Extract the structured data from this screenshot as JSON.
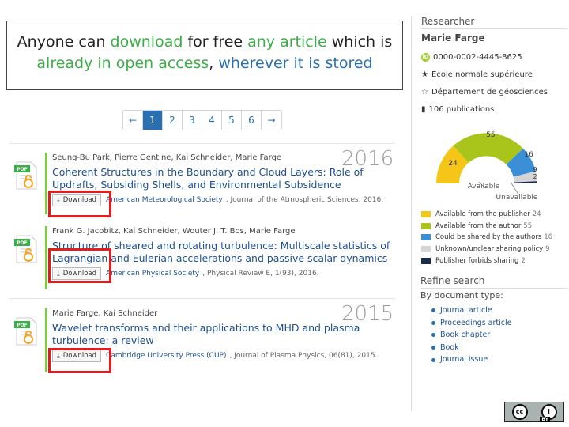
{
  "callout": {
    "p1": "Anyone can ",
    "p2": "download",
    "p3": " for free ",
    "p4": "any article",
    "p5": " which is ",
    "p6": "already in open access",
    "p7": ", ",
    "p8": "wherever it is stored"
  },
  "pager": [
    "←",
    "1",
    "2",
    "3",
    "4",
    "5",
    "6",
    "→"
  ],
  "years": [
    "2016",
    "2015"
  ],
  "download_label": "Download",
  "pdf_label": "PDF",
  "publications": [
    {
      "authors": "Seung-Bu Park, Pierre Gentine, Kai Schneider, Marie Farge",
      "title": "Coherent Structures in the Boundary and Cloud Layers: Role of Updrafts, Subsiding Shells, and Environmental Subsidence",
      "publisher": "American Meteorological Society",
      "journal": ", Journal of the Atmospheric Sciences, 2016."
    },
    {
      "authors": "Frank G. Jacobitz, Kai Schneider, Wouter J. T. Bos, Marie Farge",
      "title": "Structure of sheared and rotating turbulence: Multiscale statistics of Lagrangian and Eulerian accelerations and passive scalar dynamics",
      "publisher": "American Physical Society",
      "journal": ", Physical Review E, 1(93), 2016."
    },
    {
      "authors": "Marie Farge, Kai Schneider",
      "title": "Wavelet transforms and their applications to MHD and plasma turbulence: a review",
      "publisher": "Cambridge University Press (CUP)",
      "journal": ", Journal of Plasma Physics, 06(81), 2015."
    }
  ],
  "sidebar": {
    "heading": "Researcher",
    "name": "Marie Farge",
    "orcid": "0000-0002-4445-8625",
    "institution": "École normale supérieure",
    "department": "Département de géosciences",
    "publications": "106 publications"
  },
  "gauge": {
    "available_label": "Available",
    "unavailable_label": "Unavailable",
    "values": [
      "24",
      "55",
      "16",
      "9",
      "2"
    ]
  },
  "legend": [
    {
      "label": "Available from the publisher",
      "count": "24",
      "color": "#f5c518"
    },
    {
      "label": "Available from the author",
      "count": "55",
      "color": "#a9c41b"
    },
    {
      "label": "Could be shared by the authors",
      "count": "16",
      "color": "#3a8fd6"
    },
    {
      "label": "Unknown/unclear sharing policy",
      "count": "9",
      "color": "#d5d5d5"
    },
    {
      "label": "Publisher forbids sharing",
      "count": "2",
      "color": "#1c2a4a"
    }
  ],
  "refine": {
    "heading": "Refine search",
    "subheading": "By document type:",
    "items": [
      "Journal article",
      "Proceedings article",
      "Book chapter",
      "Book",
      "Journal issue"
    ]
  },
  "license": {
    "cc": "cc",
    "person": "i",
    "by": "BY"
  }
}
